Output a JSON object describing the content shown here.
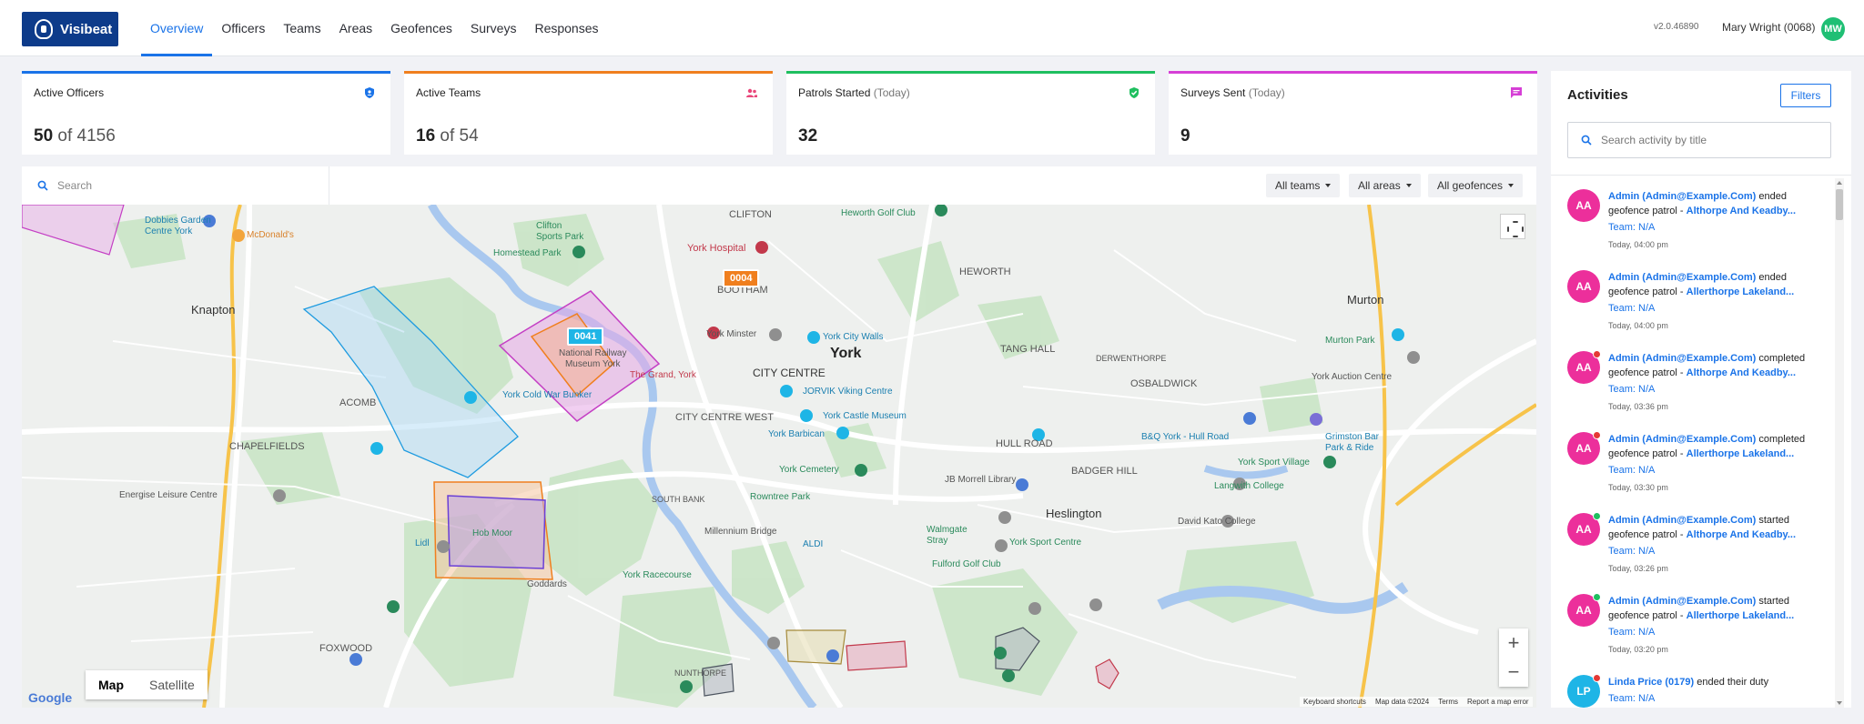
{
  "app": {
    "name": "Visibeat",
    "version": "v2.0.46890",
    "user": "Mary Wright (0068)",
    "user_initials": "MW"
  },
  "nav": [
    {
      "label": "Overview",
      "active": true
    },
    {
      "label": "Officers"
    },
    {
      "label": "Teams"
    },
    {
      "label": "Areas"
    },
    {
      "label": "Geofences"
    },
    {
      "label": "Surveys"
    },
    {
      "label": "Responses"
    }
  ],
  "stats": [
    {
      "title": "Active Officers",
      "subtitle": "",
      "value": "50",
      "of": "of 4156",
      "color": "#1a73e8",
      "icon": "shield-icon"
    },
    {
      "title": "Active Teams",
      "subtitle": "",
      "value": "16",
      "of": "of 54",
      "color": "#f07f1e",
      "icon": "people-icon"
    },
    {
      "title": "Patrols Started",
      "subtitle": "(Today)",
      "value": "32",
      "of": "",
      "color": "#1fbf5f",
      "icon": "shield-check-icon"
    },
    {
      "title": "Surveys Sent",
      "subtitle": "(Today)",
      "value": "9",
      "of": "",
      "color": "#d63fd6",
      "icon": "message-icon"
    }
  ],
  "map": {
    "search_placeholder": "Search",
    "filters": {
      "teams": "All teams",
      "areas": "All areas",
      "geofences": "All geofences"
    },
    "map_type": {
      "map": "Map",
      "satellite": "Satellite"
    },
    "zoom_in": "+",
    "zoom_out": "−",
    "google": "Google",
    "attribution": {
      "shortcuts": "Keyboard shortcuts",
      "data": "Map data ©2024",
      "terms": "Terms",
      "report": "Report a map error"
    },
    "tags": [
      {
        "label": "0004",
        "color": "#f07f1e"
      },
      {
        "label": "0041",
        "color": "#1eb5e6"
      }
    ],
    "labels": {
      "knapton": "Knapton",
      "york": "York",
      "murton": "Murton",
      "heslington": "Heslington",
      "bootham": "BOOTHAM",
      "city_centre": "CITY CENTRE",
      "city_centre_west": "CITY CENTRE WEST",
      "clifton": "CLIFTON",
      "heworth": "HEWORTH",
      "tang_hall": "TANG HALL",
      "osbaldwick": "OSBALDWICK",
      "hull_road": "HULL ROAD",
      "badger_hill": "BADGER HILL",
      "acomb": "ACOMB",
      "chapelfields": "CHAPELFIELDS",
      "foxwood": "FOXWOOD",
      "south_bank": "SOUTH BANK",
      "nunthorpe": "NUNTHORPE",
      "derwenthorpe": "DERWENTHORPE",
      "dobbies": "Dobbies Garden\nCentre York",
      "mcdonalds": "McDonald's",
      "clifton_park": "Clifton\nSports Park",
      "homestead": "Homestead Park",
      "york_hospital": "York Hospital",
      "heworth_golf": "Heworth Golf Club",
      "nrm": "National Railway\nMuseum York",
      "york_minster": "York Minster",
      "city_walls": "York City Walls",
      "grand": "The Grand, York",
      "cold_war": "York Cold War Bunker",
      "jorvik": "JORVIK Viking Centre",
      "castle_museum": "York Castle Museum",
      "barbican": "York Barbican",
      "cemetery": "York Cemetery",
      "rowntree": "Rowntree Park",
      "morrell": "JB Morrell Library",
      "walmgate": "Walmgate\nStray",
      "sport_centre": "York Sport Centre",
      "fulford": "Fulford Golf Club",
      "millennium": "Millennium Bridge",
      "energise": "Energise Leisure Centre",
      "hob_moor": "Hob Moor",
      "lidl": "Lidl",
      "aldi": "ALDI",
      "racecourse": "York Racecourse",
      "goddards": "Goddards",
      "bq": "B&Q York - Hull Road",
      "grimston": "Grimston Bar\nPark & Ride",
      "auction": "York Auction Centre",
      "murton_park": "Murton Park",
      "sport_village": "York Sport Village",
      "langwith": "Langwith College",
      "kato": "David Kato College"
    }
  },
  "activities": {
    "title": "Activities",
    "filters_label": "Filters",
    "search_placeholder": "Search activity by title",
    "items": [
      {
        "initials": "AA",
        "who": "Admin (Admin@Example.Com)",
        "action": "ended geofence patrol -",
        "target": "Althorpe And Keadby...",
        "team": "Team: N/A",
        "time": "Today, 04:00 pm",
        "dot": ""
      },
      {
        "initials": "AA",
        "who": "Admin (Admin@Example.Com)",
        "action": "ended geofence patrol -",
        "target": "Allerthorpe Lakeland...",
        "team": "Team: N/A",
        "time": "Today, 04:00 pm",
        "dot": ""
      },
      {
        "initials": "AA",
        "who": "Admin (Admin@Example.Com)",
        "action": "completed geofence patrol -",
        "target": "Althorpe And Keadby...",
        "team": "Team: N/A",
        "time": "Today, 03:36 pm",
        "dot": "#e53935"
      },
      {
        "initials": "AA",
        "who": "Admin (Admin@Example.Com)",
        "action": "completed geofence patrol -",
        "target": "Allerthorpe Lakeland...",
        "team": "Team: N/A",
        "time": "Today, 03:30 pm",
        "dot": "#e53935"
      },
      {
        "initials": "AA",
        "who": "Admin (Admin@Example.Com)",
        "action": "started geofence patrol -",
        "target": "Althorpe And Keadby...",
        "team": "Team: N/A",
        "time": "Today, 03:26 pm",
        "dot": "#1fbf5f"
      },
      {
        "initials": "AA",
        "who": "Admin (Admin@Example.Com)",
        "action": "started geofence patrol -",
        "target": "Allerthorpe Lakeland...",
        "team": "Team: N/A",
        "time": "Today, 03:20 pm",
        "dot": "#1fbf5f"
      },
      {
        "initials": "LP",
        "who": "Linda Price (0179)",
        "action": "ended their duty",
        "target": "",
        "team": "Team: N/A",
        "time": "",
        "dot": "#e53935"
      }
    ]
  }
}
